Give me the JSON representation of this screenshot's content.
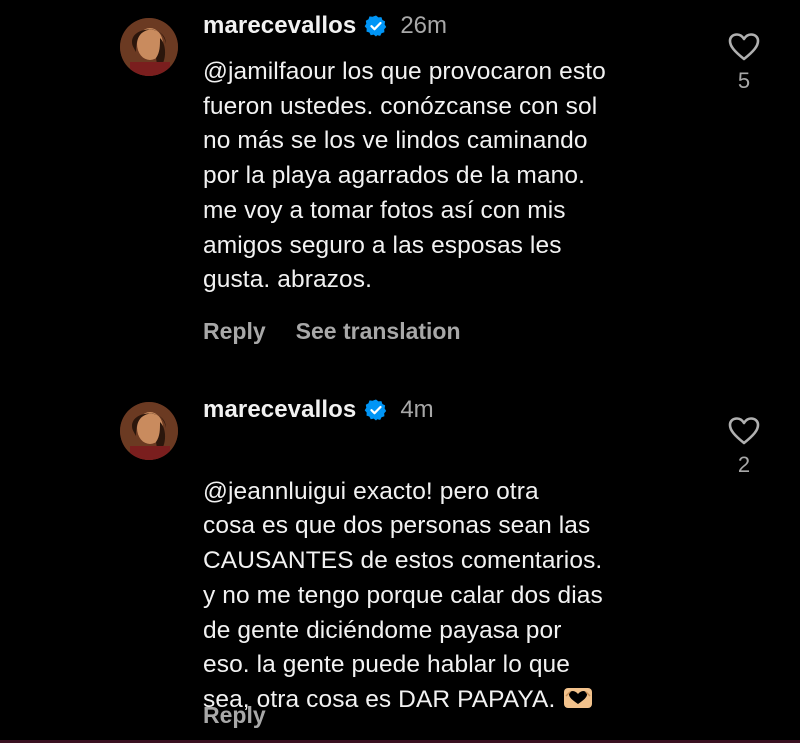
{
  "colors": {
    "background": "#000000",
    "text": "#f2f2f2",
    "muted": "#a8a8a8",
    "verified": "#0095f6"
  },
  "comments": [
    {
      "username": "marecevallos",
      "time": "26m",
      "text": "@jamilfaour los que provocaron esto\nfueron ustedes. conózcanse con sol\nno más se los ve lindos caminando\npor la playa agarrados de la mano.\nme voy a tomar fotos así con mis\namigos seguro a las esposas les\ngusta. abrazos.",
      "reply_label": "Reply",
      "translate_label": "See translation",
      "like_count": "5",
      "icons": [
        "avatar",
        "verified-badge-icon",
        "heart-icon"
      ]
    },
    {
      "username": "marecevallos",
      "time": "4m",
      "text": "@jeannluigui exacto! pero otra\ncosa es que dos personas sean las\nCAUSANTES de estos comentarios.\ny no me tengo porque calar dos dias\nde gente diciéndome payasa por\neso. la gente puede hablar lo que\nsea, otra cosa es DAR PAPAYA.",
      "reply_label": "Reply",
      "like_count": "2",
      "icons": [
        "avatar",
        "verified-badge-icon",
        "heart-icon",
        "heart-hands-emoji-icon"
      ]
    }
  ]
}
